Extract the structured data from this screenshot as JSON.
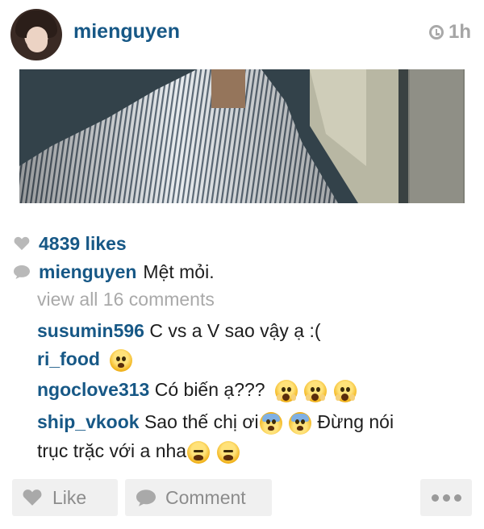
{
  "header": {
    "username": "mienguyen",
    "time": "1h",
    "clock_icon": "clock-icon"
  },
  "post": {
    "likes": "4839 likes",
    "caption": {
      "username": "mienguyen",
      "text": "Mệt mỏi."
    },
    "view_all": "view all 16 comments",
    "comments": [
      {
        "username": "susumin596",
        "text": "C vs a V sao vậy ạ :(",
        "emojis": []
      },
      {
        "username": "ri_food",
        "text": "",
        "emojis": [
          "frowning-face-emoji"
        ]
      },
      {
        "username": "ngoclove313",
        "text": "Có biến ạ???",
        "emojis": [
          "screaming-face-emoji",
          "screaming-face-emoji",
          "screaming-face-emoji"
        ]
      },
      {
        "username": "ship_vkook",
        "text": "Sao thế chị ơi",
        "text2": "Đừng nói",
        "text3": "trục trặc với a nha",
        "emojis": [
          "cold-sweat-face-emoji",
          "cold-sweat-face-emoji",
          "tired-face-emoji",
          "tired-face-emoji"
        ]
      }
    ]
  },
  "actions": {
    "like_label": "Like",
    "comment_label": "Comment",
    "more_icon": "more-dots-icon"
  },
  "colors": {
    "username_blue": "#175886",
    "muted_gray": "#a9a9a9",
    "button_bg": "#f0f0f0"
  }
}
